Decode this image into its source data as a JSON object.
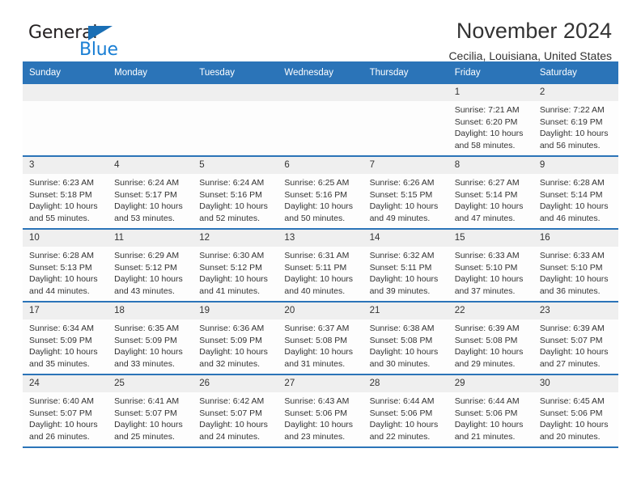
{
  "brand": {
    "name_part1": "General",
    "name_part2": "Blue",
    "triangle_icon": "blue-triangle-logo-mark",
    "accent_color": "#1a7fd4"
  },
  "header": {
    "title": "November 2024",
    "subtitle": "Cecilia, Louisiana, United States"
  },
  "theme": {
    "header_bar_color": "#2b74b8",
    "daynum_band_color": "#efefef",
    "text_color": "#333333"
  },
  "weekdays": [
    "Sunday",
    "Monday",
    "Tuesday",
    "Wednesday",
    "Thursday",
    "Friday",
    "Saturday"
  ],
  "labels": {
    "sunrise_prefix": "Sunrise:",
    "sunset_prefix": "Sunset:",
    "daylight_prefix": "Daylight:"
  },
  "weeks": [
    [
      {
        "day": "",
        "line1": "",
        "line2": "",
        "line3": "",
        "line4": ""
      },
      {
        "day": "",
        "line1": "",
        "line2": "",
        "line3": "",
        "line4": ""
      },
      {
        "day": "",
        "line1": "",
        "line2": "",
        "line3": "",
        "line4": ""
      },
      {
        "day": "",
        "line1": "",
        "line2": "",
        "line3": "",
        "line4": ""
      },
      {
        "day": "",
        "line1": "",
        "line2": "",
        "line3": "",
        "line4": ""
      },
      {
        "day": "1",
        "line1": "Sunrise: 7:21 AM",
        "line2": "Sunset: 6:20 PM",
        "line3": "Daylight: 10 hours",
        "line4": "and 58 minutes."
      },
      {
        "day": "2",
        "line1": "Sunrise: 7:22 AM",
        "line2": "Sunset: 6:19 PM",
        "line3": "Daylight: 10 hours",
        "line4": "and 56 minutes."
      }
    ],
    [
      {
        "day": "3",
        "line1": "Sunrise: 6:23 AM",
        "line2": "Sunset: 5:18 PM",
        "line3": "Daylight: 10 hours",
        "line4": "and 55 minutes."
      },
      {
        "day": "4",
        "line1": "Sunrise: 6:24 AM",
        "line2": "Sunset: 5:17 PM",
        "line3": "Daylight: 10 hours",
        "line4": "and 53 minutes."
      },
      {
        "day": "5",
        "line1": "Sunrise: 6:24 AM",
        "line2": "Sunset: 5:16 PM",
        "line3": "Daylight: 10 hours",
        "line4": "and 52 minutes."
      },
      {
        "day": "6",
        "line1": "Sunrise: 6:25 AM",
        "line2": "Sunset: 5:16 PM",
        "line3": "Daylight: 10 hours",
        "line4": "and 50 minutes."
      },
      {
        "day": "7",
        "line1": "Sunrise: 6:26 AM",
        "line2": "Sunset: 5:15 PM",
        "line3": "Daylight: 10 hours",
        "line4": "and 49 minutes."
      },
      {
        "day": "8",
        "line1": "Sunrise: 6:27 AM",
        "line2": "Sunset: 5:14 PM",
        "line3": "Daylight: 10 hours",
        "line4": "and 47 minutes."
      },
      {
        "day": "9",
        "line1": "Sunrise: 6:28 AM",
        "line2": "Sunset: 5:14 PM",
        "line3": "Daylight: 10 hours",
        "line4": "and 46 minutes."
      }
    ],
    [
      {
        "day": "10",
        "line1": "Sunrise: 6:28 AM",
        "line2": "Sunset: 5:13 PM",
        "line3": "Daylight: 10 hours",
        "line4": "and 44 minutes."
      },
      {
        "day": "11",
        "line1": "Sunrise: 6:29 AM",
        "line2": "Sunset: 5:12 PM",
        "line3": "Daylight: 10 hours",
        "line4": "and 43 minutes."
      },
      {
        "day": "12",
        "line1": "Sunrise: 6:30 AM",
        "line2": "Sunset: 5:12 PM",
        "line3": "Daylight: 10 hours",
        "line4": "and 41 minutes."
      },
      {
        "day": "13",
        "line1": "Sunrise: 6:31 AM",
        "line2": "Sunset: 5:11 PM",
        "line3": "Daylight: 10 hours",
        "line4": "and 40 minutes."
      },
      {
        "day": "14",
        "line1": "Sunrise: 6:32 AM",
        "line2": "Sunset: 5:11 PM",
        "line3": "Daylight: 10 hours",
        "line4": "and 39 minutes."
      },
      {
        "day": "15",
        "line1": "Sunrise: 6:33 AM",
        "line2": "Sunset: 5:10 PM",
        "line3": "Daylight: 10 hours",
        "line4": "and 37 minutes."
      },
      {
        "day": "16",
        "line1": "Sunrise: 6:33 AM",
        "line2": "Sunset: 5:10 PM",
        "line3": "Daylight: 10 hours",
        "line4": "and 36 minutes."
      }
    ],
    [
      {
        "day": "17",
        "line1": "Sunrise: 6:34 AM",
        "line2": "Sunset: 5:09 PM",
        "line3": "Daylight: 10 hours",
        "line4": "and 35 minutes."
      },
      {
        "day": "18",
        "line1": "Sunrise: 6:35 AM",
        "line2": "Sunset: 5:09 PM",
        "line3": "Daylight: 10 hours",
        "line4": "and 33 minutes."
      },
      {
        "day": "19",
        "line1": "Sunrise: 6:36 AM",
        "line2": "Sunset: 5:09 PM",
        "line3": "Daylight: 10 hours",
        "line4": "and 32 minutes."
      },
      {
        "day": "20",
        "line1": "Sunrise: 6:37 AM",
        "line2": "Sunset: 5:08 PM",
        "line3": "Daylight: 10 hours",
        "line4": "and 31 minutes."
      },
      {
        "day": "21",
        "line1": "Sunrise: 6:38 AM",
        "line2": "Sunset: 5:08 PM",
        "line3": "Daylight: 10 hours",
        "line4": "and 30 minutes."
      },
      {
        "day": "22",
        "line1": "Sunrise: 6:39 AM",
        "line2": "Sunset: 5:08 PM",
        "line3": "Daylight: 10 hours",
        "line4": "and 29 minutes."
      },
      {
        "day": "23",
        "line1": "Sunrise: 6:39 AM",
        "line2": "Sunset: 5:07 PM",
        "line3": "Daylight: 10 hours",
        "line4": "and 27 minutes."
      }
    ],
    [
      {
        "day": "24",
        "line1": "Sunrise: 6:40 AM",
        "line2": "Sunset: 5:07 PM",
        "line3": "Daylight: 10 hours",
        "line4": "and 26 minutes."
      },
      {
        "day": "25",
        "line1": "Sunrise: 6:41 AM",
        "line2": "Sunset: 5:07 PM",
        "line3": "Daylight: 10 hours",
        "line4": "and 25 minutes."
      },
      {
        "day": "26",
        "line1": "Sunrise: 6:42 AM",
        "line2": "Sunset: 5:07 PM",
        "line3": "Daylight: 10 hours",
        "line4": "and 24 minutes."
      },
      {
        "day": "27",
        "line1": "Sunrise: 6:43 AM",
        "line2": "Sunset: 5:06 PM",
        "line3": "Daylight: 10 hours",
        "line4": "and 23 minutes."
      },
      {
        "day": "28",
        "line1": "Sunrise: 6:44 AM",
        "line2": "Sunset: 5:06 PM",
        "line3": "Daylight: 10 hours",
        "line4": "and 22 minutes."
      },
      {
        "day": "29",
        "line1": "Sunrise: 6:44 AM",
        "line2": "Sunset: 5:06 PM",
        "line3": "Daylight: 10 hours",
        "line4": "and 21 minutes."
      },
      {
        "day": "30",
        "line1": "Sunrise: 6:45 AM",
        "line2": "Sunset: 5:06 PM",
        "line3": "Daylight: 10 hours",
        "line4": "and 20 minutes."
      }
    ]
  ]
}
